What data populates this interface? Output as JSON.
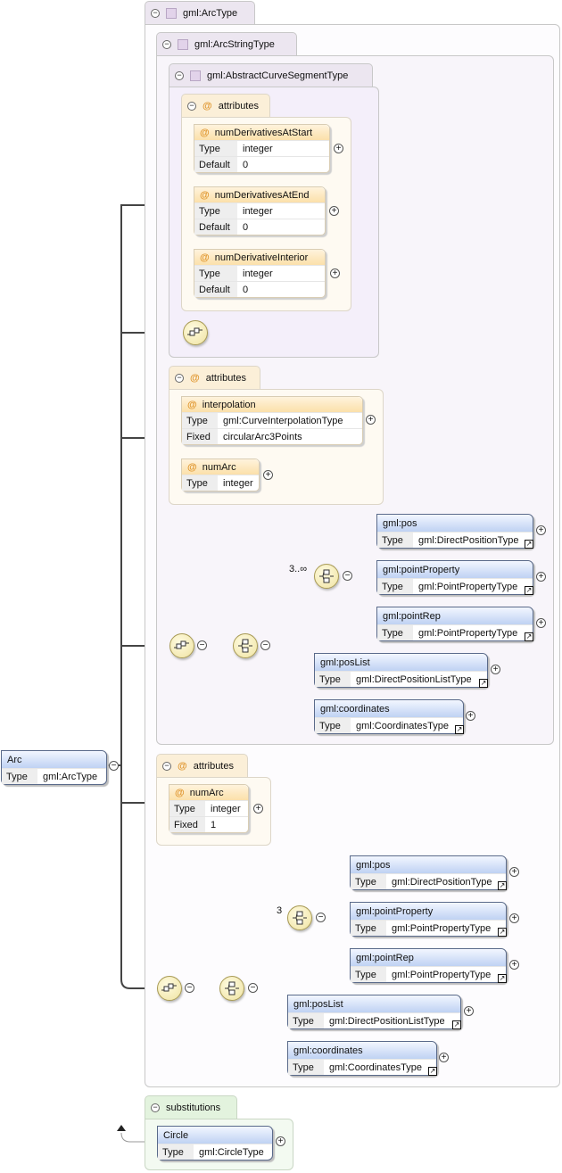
{
  "root": {
    "name": "Arc",
    "type_key": "Type",
    "type_value": "gml:ArcType"
  },
  "arc_type": {
    "label": "gml:ArcType"
  },
  "arc_string_type": {
    "label": "gml:ArcStringType"
  },
  "abstract_curve": {
    "label": "gml:AbstractCurveSegmentType"
  },
  "attr_group_1": {
    "label": "attributes",
    "items": [
      {
        "name": "numDerivativesAtStart",
        "type_key": "Type",
        "type": "integer",
        "default_key": "Default",
        "default": "0"
      },
      {
        "name": "numDerivativesAtEnd",
        "type_key": "Type",
        "type": "integer",
        "default_key": "Default",
        "default": "0"
      },
      {
        "name": "numDerivativeInterior",
        "type_key": "Type",
        "type": "integer",
        "default_key": "Default",
        "default": "0"
      }
    ]
  },
  "attr_group_2": {
    "label": "attributes",
    "interpolation": {
      "name": "interpolation",
      "type_key": "Type",
      "type": "gml:CurveInterpolationType",
      "fixed_key": "Fixed",
      "fixed": "circularArc3Points"
    },
    "numArc": {
      "name": "numArc",
      "type_key": "Type",
      "type": "integer"
    }
  },
  "attr_group_3": {
    "label": "attributes",
    "numArc": {
      "name": "numArc",
      "type_key": "Type",
      "type": "integer",
      "fixed_key": "Fixed",
      "fixed": "1"
    }
  },
  "choice_1": {
    "cardinality": "3..∞",
    "elements": [
      {
        "name": "gml:pos",
        "type_key": "Type",
        "type": "gml:DirectPositionType"
      },
      {
        "name": "gml:pointProperty",
        "type_key": "Type",
        "type": "gml:PointPropertyType"
      },
      {
        "name": "gml:pointRep",
        "type_key": "Type",
        "type": "gml:PointPropertyType"
      },
      {
        "name": "gml:posList",
        "type_key": "Type",
        "type": "gml:DirectPositionListType"
      },
      {
        "name": "gml:coordinates",
        "type_key": "Type",
        "type": "gml:CoordinatesType"
      }
    ]
  },
  "choice_2": {
    "cardinality": "3",
    "elements": [
      {
        "name": "gml:pos",
        "type_key": "Type",
        "type": "gml:DirectPositionType"
      },
      {
        "name": "gml:pointProperty",
        "type_key": "Type",
        "type": "gml:PointPropertyType"
      },
      {
        "name": "gml:pointRep",
        "type_key": "Type",
        "type": "gml:PointPropertyType"
      },
      {
        "name": "gml:posList",
        "type_key": "Type",
        "type": "gml:DirectPositionListType"
      },
      {
        "name": "gml:coordinates",
        "type_key": "Type",
        "type": "gml:CoordinatesType"
      }
    ]
  },
  "substitutions": {
    "label": "substitutions",
    "element": {
      "name": "Circle",
      "type_key": "Type",
      "type": "gml:CircleType"
    }
  },
  "glyphs": {
    "minus": "−",
    "plus": "+",
    "link": "↗",
    "at": "@"
  },
  "icons": [
    "sequence-compositor-icon",
    "choice-compositor-icon",
    "expand-icon",
    "collapse-icon"
  ]
}
